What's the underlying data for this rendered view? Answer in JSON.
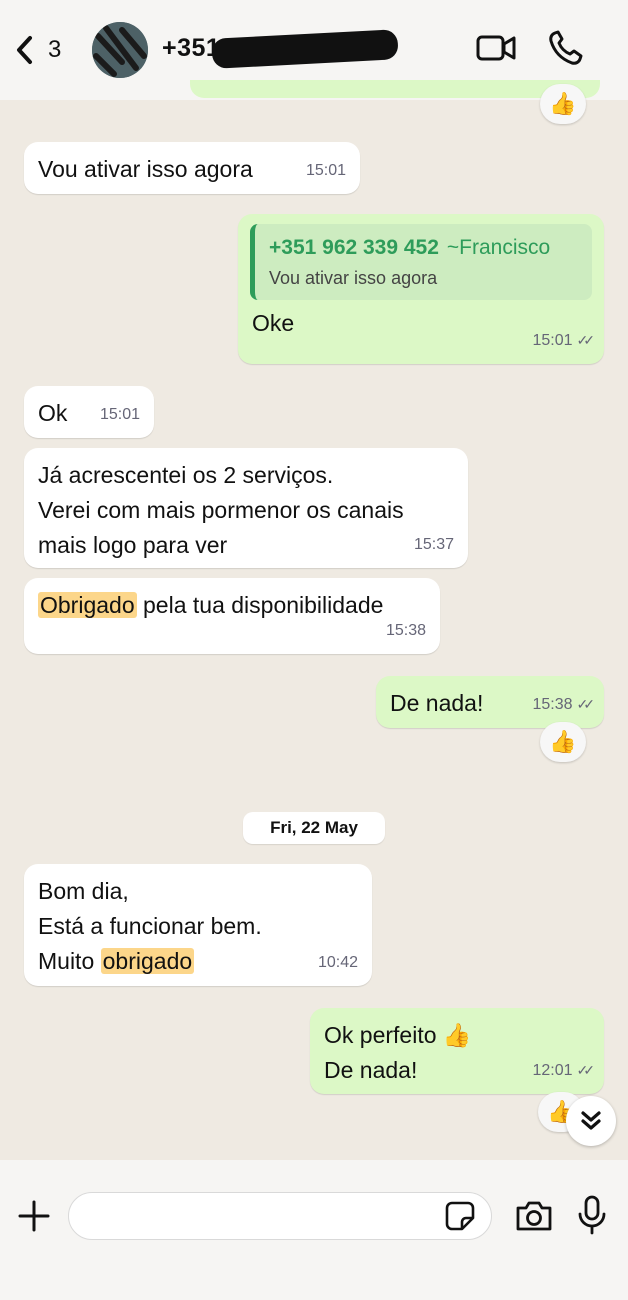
{
  "header": {
    "back_count": "3",
    "contact_name": "+351",
    "icons": [
      "chevron-left-icon",
      "video-call-icon",
      "phone-icon"
    ]
  },
  "messages": [
    {
      "dir": "in",
      "text": "Vou ativar isso agora",
      "time": "15:01"
    },
    {
      "dir": "out",
      "quote_author": "+351 962 339 452",
      "quote_name": "~Francisco",
      "quote_text": "Vou ativar isso agora",
      "text": "Oke",
      "time": "15:01"
    },
    {
      "dir": "in",
      "text": "Ok",
      "time": "15:01"
    },
    {
      "dir": "in",
      "text": "Já acrescentei os 2 serviços.\nVerei com mais pormenor os canais\nmais logo para ver",
      "time": "15:37"
    },
    {
      "dir": "in",
      "text_highlight": "Obrigado",
      "text_rest": " pela tua disponibilidade",
      "time": "15:38"
    },
    {
      "dir": "out",
      "text": "De nada!",
      "time": "15:38"
    },
    {
      "dir": "in",
      "text_pre": "Bom dia,\nEstá a funcionar bem.\nMuito ",
      "text_highlight": "obrigado",
      "time": "10:42"
    },
    {
      "dir": "out",
      "text": "Ok perfeito 👍\nDe nada!",
      "time": "12:01"
    }
  ],
  "reactions": [
    "👍",
    "👍",
    "👍"
  ],
  "date_separator": "Fri, 22 May",
  "composer": {
    "placeholder": "",
    "icons": [
      "plus-icon",
      "sticker-icon",
      "camera-icon",
      "microphone-icon"
    ]
  },
  "colors": {
    "incoming": "#ffffff",
    "outgoing": "#dcf8c6",
    "accent": "#2e9c5a",
    "highlight": "#fcd68a",
    "background": "#efeae2"
  }
}
